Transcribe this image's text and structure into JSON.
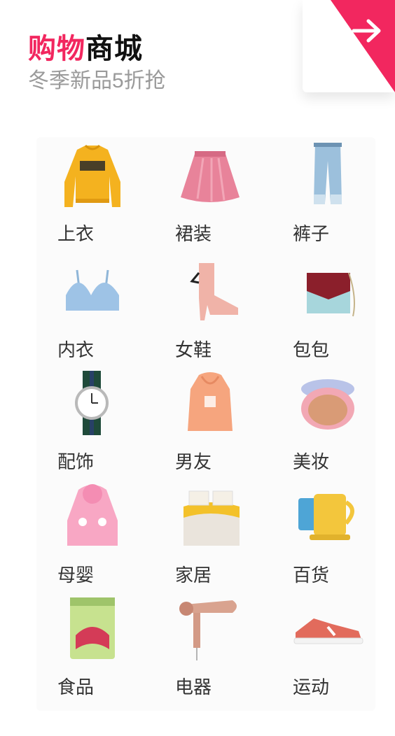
{
  "header": {
    "title_part1": "购物",
    "title_part2": "商城",
    "subtitle": "冬季新品5折抢"
  },
  "corner_button": {
    "icon": "arrow-right-icon",
    "color": "#f2275f"
  },
  "categories": [
    {
      "label": "上衣",
      "icon": "sweater-icon"
    },
    {
      "label": "裙装",
      "icon": "skirt-icon"
    },
    {
      "label": "裤子",
      "icon": "jeans-icon"
    },
    {
      "label": "内衣",
      "icon": "bra-icon"
    },
    {
      "label": "女鞋",
      "icon": "boot-icon"
    },
    {
      "label": "包包",
      "icon": "handbag-icon"
    },
    {
      "label": "配饰",
      "icon": "watch-icon"
    },
    {
      "label": "男友",
      "icon": "hoodie-icon"
    },
    {
      "label": "美妆",
      "icon": "cushion-compact-icon"
    },
    {
      "label": "母婴",
      "icon": "baby-jacket-icon"
    },
    {
      "label": "家居",
      "icon": "bedding-icon"
    },
    {
      "label": "百货",
      "icon": "cups-icon"
    },
    {
      "label": "食品",
      "icon": "snack-bag-icon"
    },
    {
      "label": "电器",
      "icon": "hair-dryer-icon"
    },
    {
      "label": "运动",
      "icon": "sneaker-icon"
    }
  ],
  "colors": {
    "accent": "#f2275f",
    "text": "#333333",
    "subtitle": "#9a9a9a"
  }
}
